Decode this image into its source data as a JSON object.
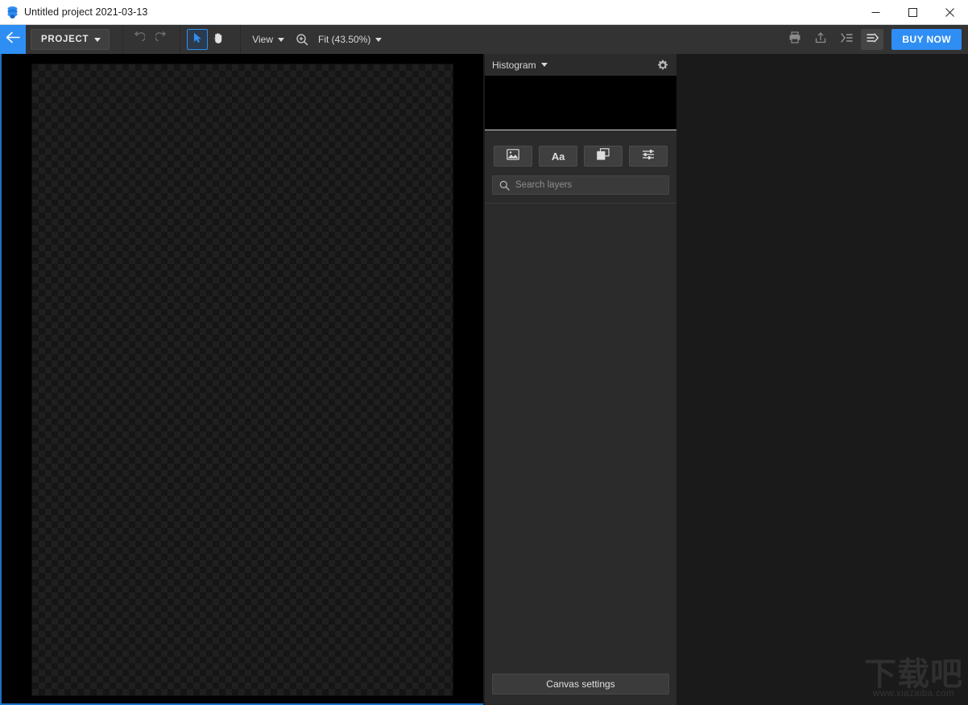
{
  "window": {
    "title": "Untitled project 2021-03-13",
    "app_icon": "layers-stack-icon",
    "controls": {
      "minimize": "minimize-icon",
      "maximize": "maximize-icon",
      "close": "close-icon"
    }
  },
  "toolbar": {
    "back_label": "back-arrow-icon",
    "project_label": "PROJECT",
    "undo_label": "undo-icon",
    "redo_label": "redo-icon",
    "select_tool_label": "cursor-arrow-icon",
    "hand_tool_label": "hand-icon",
    "view_label": "View",
    "zoom_icon": "magnifier-plus-icon",
    "zoom_label": "Fit (43.50%)",
    "print_label": "print-icon",
    "export_label": "export-upload-icon",
    "collapse_panel_label": "collapse-panel-icon",
    "expand_panel_label": "expand-panel-icon",
    "buy_now_label": "BUY NOW",
    "accent_color": "#2f8ef4"
  },
  "panel": {
    "histogram_title": "Histogram",
    "settings_icon": "gear-icon",
    "layer_tools": [
      {
        "name": "add-image-layer",
        "icon": "image-icon",
        "label": ""
      },
      {
        "name": "add-text-layer",
        "icon": "text-icon",
        "label": "Aa"
      },
      {
        "name": "add-shape-layer",
        "icon": "shapes-icon",
        "label": ""
      },
      {
        "name": "add-adjustment-layer",
        "icon": "sliders-icon",
        "label": ""
      }
    ],
    "search_placeholder": "Search layers",
    "search_value": "",
    "search_icon": "search-icon",
    "canvas_settings_label": "Canvas settings"
  },
  "canvas": {
    "background": "transparent-checkerboard",
    "zoom_percent": "43.50%"
  },
  "watermark": {
    "text_cn": "下载吧",
    "url": "www.xiazaiba.com"
  }
}
